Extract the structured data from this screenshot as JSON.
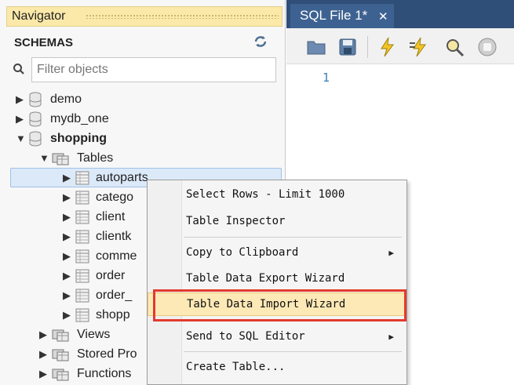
{
  "navigator": {
    "title": "Navigator",
    "schemas_label": "SCHEMAS",
    "filter_placeholder": "Filter objects",
    "tree": {
      "demo": "demo",
      "mydb_one": "mydb_one",
      "shopping": "shopping",
      "tables": "Tables",
      "table_items": [
        "autoparts",
        "catego",
        "client",
        "clientk",
        "comme",
        "order",
        "order_",
        "shopp"
      ],
      "views": "Views",
      "stored_procedures": "Stored Pro",
      "functions": "Functions"
    }
  },
  "editor": {
    "tab_label": "SQL File 1*",
    "line_number": "1"
  },
  "context_menu": {
    "items": [
      "Select Rows - Limit 1000",
      "Table Inspector",
      "Copy to Clipboard",
      "Table Data Export Wizard",
      "Table Data Import Wizard",
      "Send to SQL Editor",
      "Create Table..."
    ]
  },
  "colors": {
    "nav_header": "#fbe9a9",
    "tab_bar": "#2f4e78",
    "highlight": "#fde9b6",
    "callout": "#e33a2e"
  },
  "icons": {
    "refresh": "refresh-icon",
    "search": "search-icon",
    "database": "database-icon",
    "folder": "folder-icon",
    "table": "table-icon"
  }
}
